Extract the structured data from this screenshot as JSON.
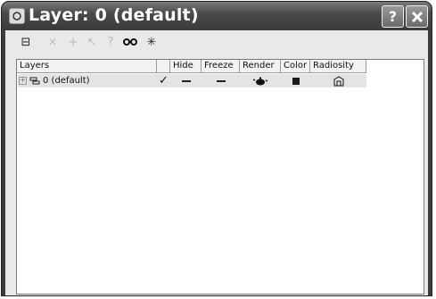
{
  "window": {
    "title": "Layer: 0 (default)",
    "help_button": "?",
    "close_button": "✕"
  },
  "toolbar": {
    "tools": [
      {
        "icon": "new-layer-icon",
        "glyph": "⊟",
        "enabled": true
      },
      {
        "icon": "delete-icon",
        "glyph": "×",
        "enabled": false
      },
      {
        "icon": "add-icon",
        "glyph": "+",
        "enabled": false
      },
      {
        "icon": "select-icon",
        "glyph": "↖",
        "enabled": false
      },
      {
        "icon": "help-icon",
        "glyph": "?",
        "enabled": false
      },
      {
        "icon": "select-highlight-icon",
        "glyph": "👓",
        "enabled": true
      },
      {
        "icon": "current-layer-icon",
        "glyph": "✳",
        "enabled": true
      }
    ]
  },
  "columns": [
    "Layers",
    "",
    "Hide",
    "Freeze",
    "Render",
    "Color",
    "Radiosity"
  ],
  "rows": [
    {
      "expander": "⊞",
      "name": "0 (default)",
      "current_mark": "✓",
      "hide": "—",
      "freeze": "—",
      "render_icon": "teapot-icon",
      "color": "#1a1a1a",
      "radiosity_icon": "radiosity-icon"
    }
  ]
}
